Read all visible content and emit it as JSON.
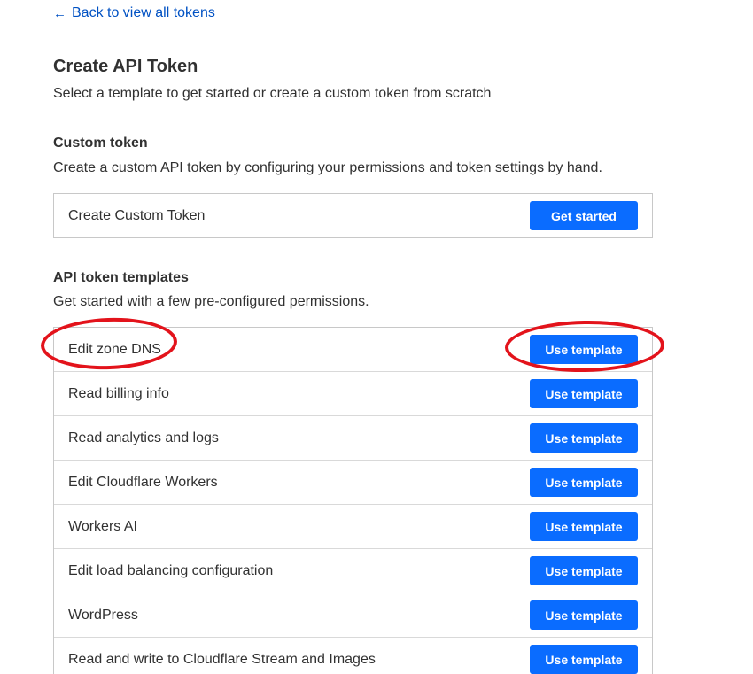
{
  "nav": {
    "back_label": "Back to view all tokens",
    "back_icon": "arrow-left-icon"
  },
  "header": {
    "title": "Create API Token",
    "subtitle": "Select a template to get started or create a custom token from scratch"
  },
  "custom": {
    "title": "Custom token",
    "description": "Create a custom API token by configuring your permissions and token settings by hand.",
    "row_label": "Create Custom Token",
    "button_label": "Get started"
  },
  "templates": {
    "title": "API token templates",
    "description": "Get started with a few pre-configured permissions.",
    "items": [
      {
        "label": "Edit zone DNS",
        "button_label": "Use template"
      },
      {
        "label": "Read billing info",
        "button_label": "Use template"
      },
      {
        "label": "Read analytics and logs",
        "button_label": "Use template"
      },
      {
        "label": "Edit Cloudflare Workers",
        "button_label": "Use template"
      },
      {
        "label": "Workers AI",
        "button_label": "Use template"
      },
      {
        "label": "Edit load balancing configuration",
        "button_label": "Use template"
      },
      {
        "label": "WordPress",
        "button_label": "Use template"
      },
      {
        "label": "Read and write to Cloudflare Stream and Images",
        "button_label": "Use template"
      }
    ]
  },
  "colors": {
    "accent": "#0a6cff",
    "link": "#0051c3",
    "annotation": "#e3131b"
  }
}
